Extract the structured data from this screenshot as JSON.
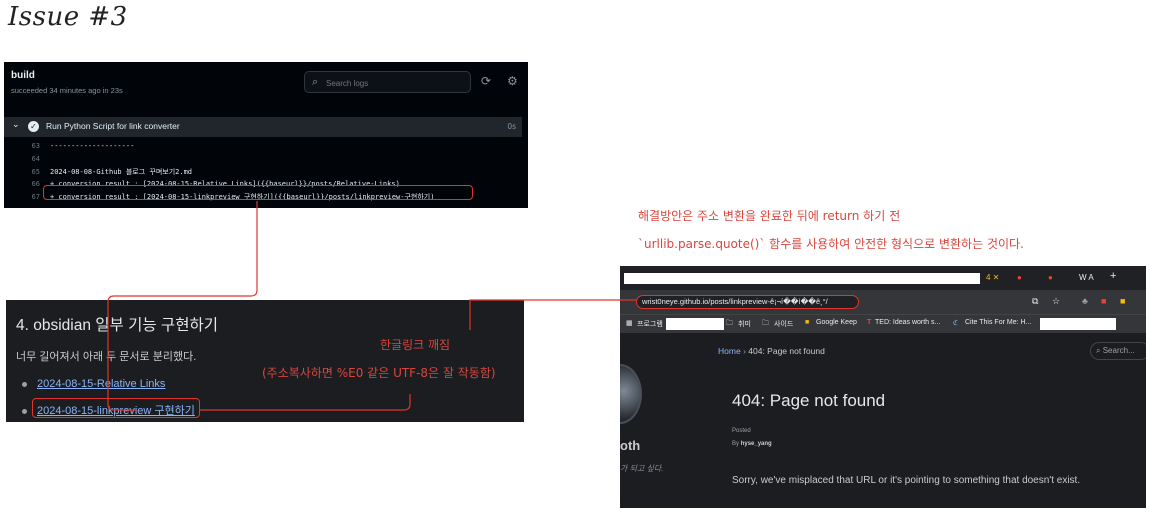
{
  "page_title": "Issue #3",
  "github": {
    "job_title": "build",
    "job_subtitle": "succeeded 34 minutes ago in 23s",
    "search_placeholder": "Search logs",
    "step_name": "Run Python Script for link converter",
    "step_duration": "0s",
    "log_lines": [
      {
        "n": "63",
        "t": "--------------------"
      },
      {
        "n": "64",
        "t": ""
      },
      {
        "n": "65",
        "t": "2024-08-08-Github 블로그 꾸며보기2.md"
      },
      {
        "n": "66",
        "t": "+ conversion result : [2024-08-15-Relative Links]({{baseurl}}/posts/Relative-Links)"
      },
      {
        "n": "67",
        "t": "+ conversion result : [2024-08-15-linkpreview 구현하기]({{baseurl}}/posts/linkpreview-구현하기)"
      }
    ]
  },
  "blog": {
    "heading": "4. obsidian 일부 기능 구현하기",
    "paragraph": "너무 길어져서 아래 두 문서로 분리했다.",
    "links": [
      "2024-08-15-Relative Links",
      "2024-08-15-linkpreview 구현하기"
    ]
  },
  "browser": {
    "url": "wrist0neye.github.io/posts/linkpreview-ê¡¬í��ì��ê¸°/",
    "bookmarks": {
      "apps": "프로그램",
      "folder1": "취미",
      "folder2": "사이드",
      "keep": "Google Keep",
      "ted": "TED: Ideas worth s...",
      "cite": "Cite This For Me: H..."
    },
    "crumb_home": "Home",
    "crumb_current": "404: Page not found",
    "search_label": "Search...",
    "sidebar_name": "oth",
    "sidebar_sub": "가 되고 싶다.",
    "heading": "404: Page not found",
    "posted_label": "Posted",
    "by_prefix": "By",
    "author": "hyse_yang",
    "message": "Sorry, we've misplaced that URL or it's pointing to something that doesn't exist."
  },
  "annotations": {
    "solution_line1": "해결방안은 주소 변환을 완료한 뒤에 return 하기 전",
    "solution_line2": "`urllib.parse.quote()` 함수를 사용하여 안전한 형식으로 변환하는 것이다.",
    "broken_title": "한글링크 깨짐",
    "broken_detail": "(주소복사하면 %E0 같은 UTF-8은 잘 작동함)"
  },
  "colors": {
    "annotation": "#d9463e",
    "highlight_box": "#e0352b",
    "link": "#8ab4f8"
  }
}
